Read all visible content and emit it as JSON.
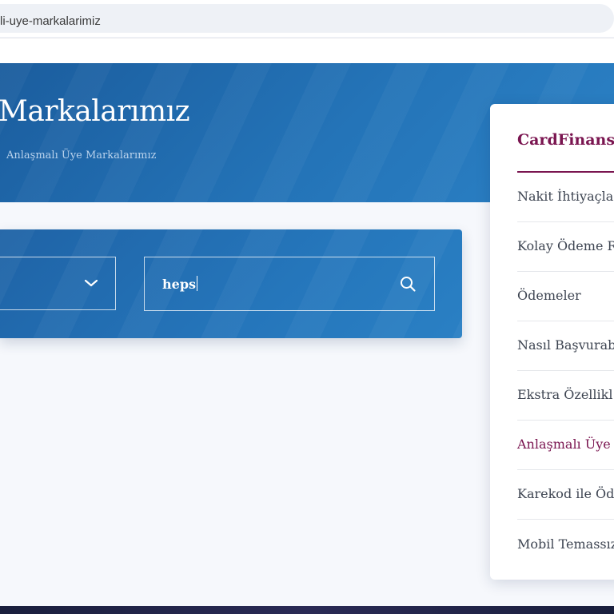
{
  "browser": {
    "url": "li-uye-markalarimiz"
  },
  "hero": {
    "title": "Markalarımız",
    "breadcrumb": "Anlaşmalı Üye Markalarımız"
  },
  "search": {
    "query": "heps"
  },
  "sidebar": {
    "title": "CardFinans I",
    "items": [
      {
        "label": "Nakit İhtiyaçla"
      },
      {
        "label": "Kolay Ödeme R"
      },
      {
        "label": "Ödemeler"
      },
      {
        "label": "Nasıl Başvurab"
      },
      {
        "label": "Ekstra Özellikl"
      },
      {
        "label": "Anlaşmalı Üye",
        "active": true
      },
      {
        "label": "Karekod ile Öd"
      },
      {
        "label": "Mobil Temassız"
      }
    ]
  },
  "colors": {
    "accent": "#7a1550",
    "hero_blue": "#2474b8"
  }
}
